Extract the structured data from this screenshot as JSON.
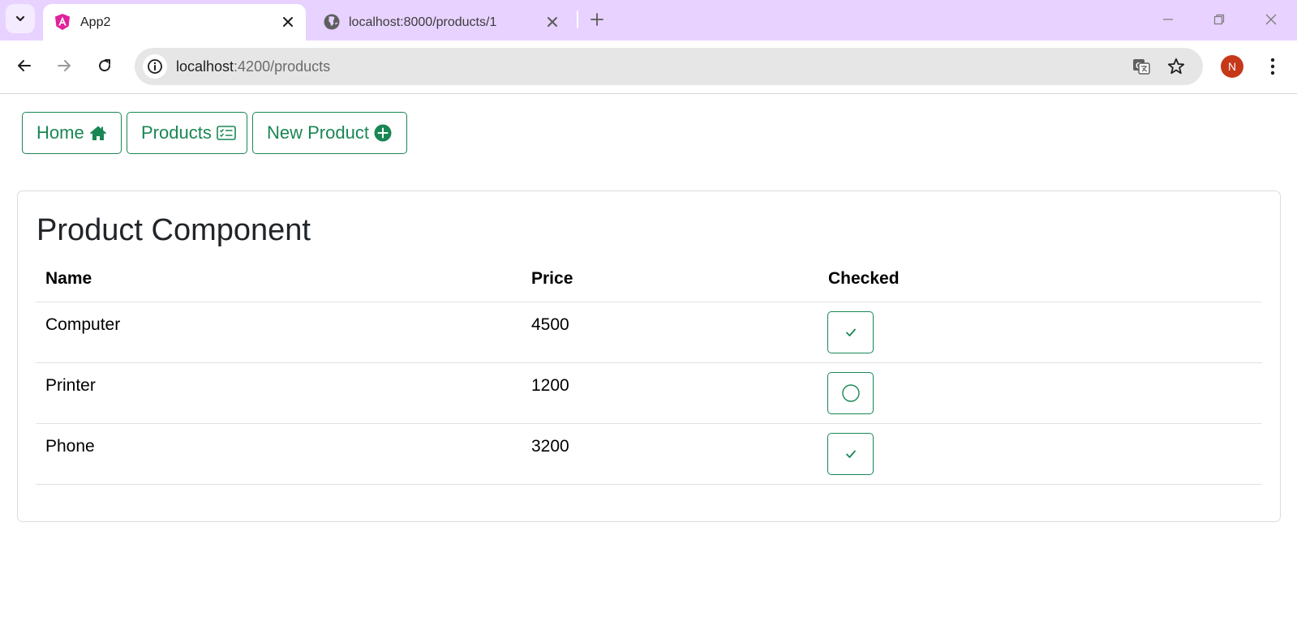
{
  "browser": {
    "tabs": [
      {
        "title": "App2",
        "favicon": "angular-icon",
        "active": true
      },
      {
        "title": "localhost:8000/products/1",
        "favicon": "globe-icon",
        "active": false
      }
    ],
    "url_host": "localhost",
    "url_rest": ":4200/products",
    "profile_initial": "N"
  },
  "nav": {
    "home": "Home",
    "products": "Products",
    "new_product": "New Product"
  },
  "card": {
    "title": "Product Component",
    "columns": [
      "Name",
      "Price",
      "Checked"
    ],
    "rows": [
      {
        "name": "Computer",
        "price": "4500",
        "checked": true
      },
      {
        "name": "Printer",
        "price": "1200",
        "checked": false
      },
      {
        "name": "Phone",
        "price": "3200",
        "checked": true
      }
    ]
  },
  "colors": {
    "accent": "#198754",
    "tabbar": "#e8d2ff",
    "avatar": "#c5391a"
  }
}
